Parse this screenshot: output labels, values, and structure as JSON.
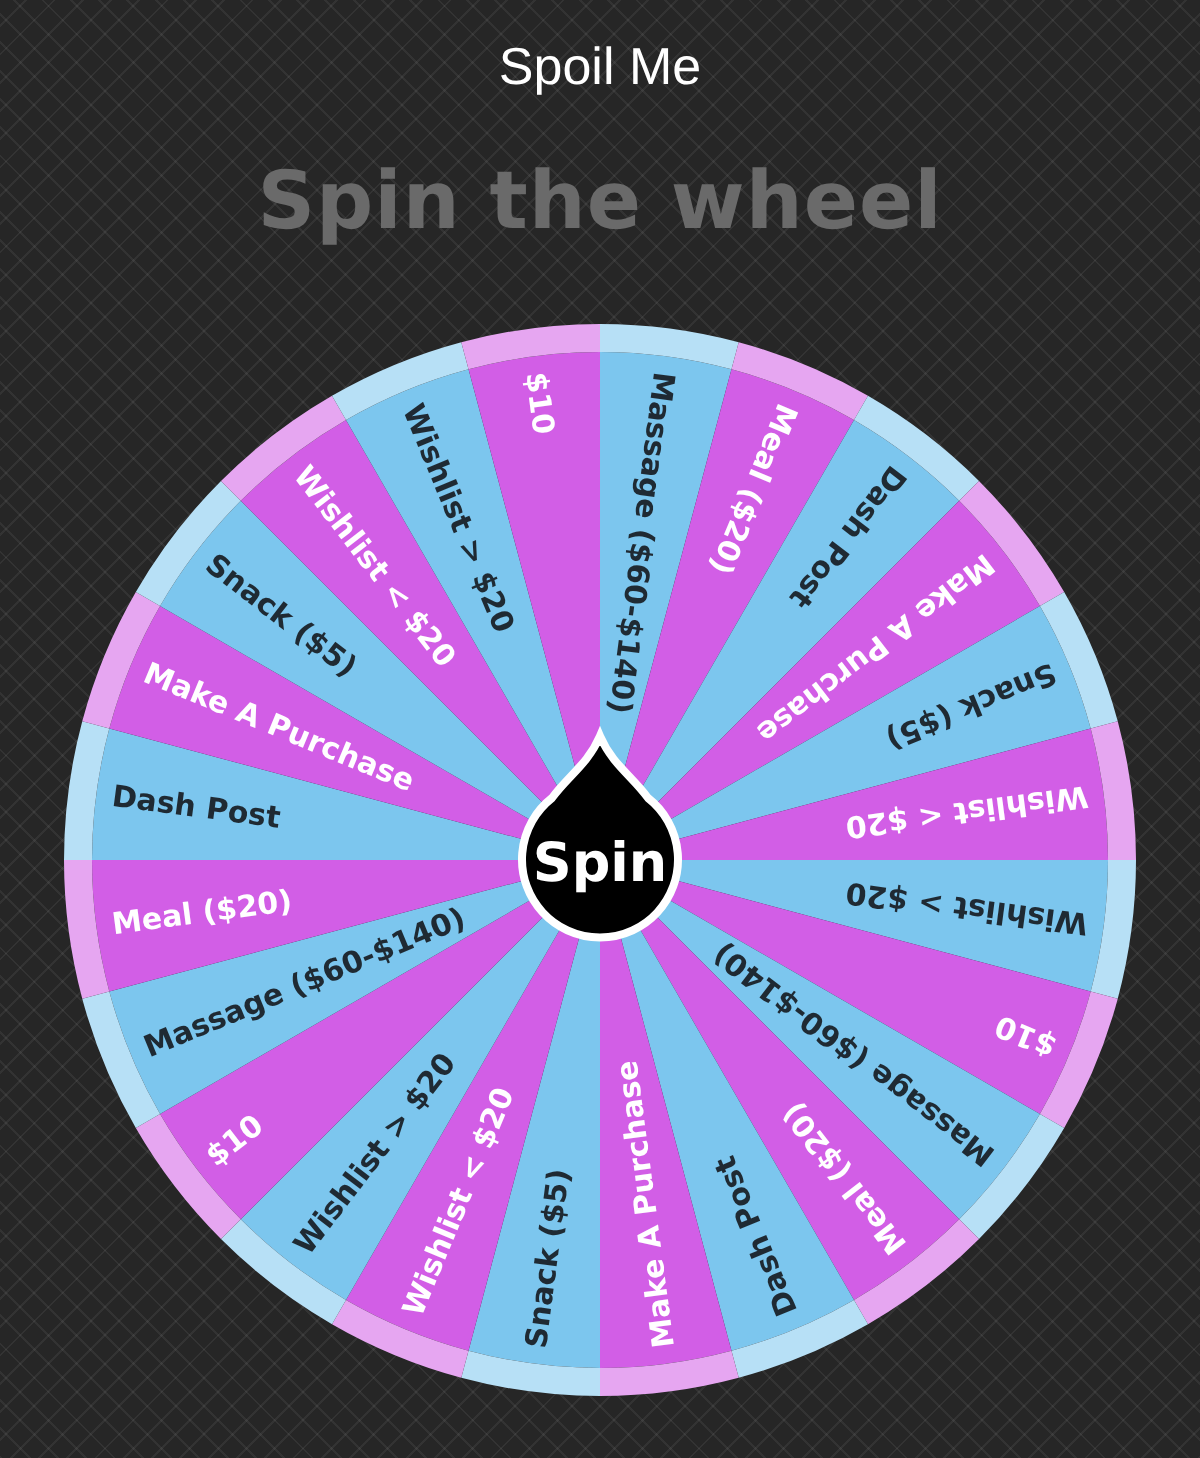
{
  "header": {
    "title": "Spoil Me"
  },
  "heading": "Spin the wheel",
  "wheel": {
    "segments": [
      {
        "label": "Massage ($60-$140)",
        "color": "#7cc6ee"
      },
      {
        "label": "Meal ($20)",
        "color": "#d25ee6"
      },
      {
        "label": "Dash Post",
        "color": "#7cc6ee"
      },
      {
        "label": "Make A Purchase",
        "color": "#d25ee6"
      },
      {
        "label": "Snack ($5)",
        "color": "#7cc6ee"
      },
      {
        "label": "Wishlist < $20",
        "color": "#d25ee6"
      },
      {
        "label": "Wishlist > $20",
        "color": "#7cc6ee"
      },
      {
        "label": "$10",
        "color": "#d25ee6"
      },
      {
        "label": "Massage ($60-$140)",
        "color": "#7cc6ee"
      },
      {
        "label": "Meal ($20)",
        "color": "#d25ee6"
      },
      {
        "label": "Dash Post",
        "color": "#7cc6ee"
      },
      {
        "label": "Make A Purchase",
        "color": "#d25ee6"
      },
      {
        "label": "Snack ($5)",
        "color": "#7cc6ee"
      },
      {
        "label": "Wishlist < $20",
        "color": "#d25ee6"
      },
      {
        "label": "Wishlist > $20",
        "color": "#7cc6ee"
      },
      {
        "label": "$10",
        "color": "#d25ee6"
      },
      {
        "label": "Massage ($60-$140)",
        "color": "#7cc6ee"
      },
      {
        "label": "Meal ($20)",
        "color": "#d25ee6"
      },
      {
        "label": "Dash Post",
        "color": "#7cc6ee"
      },
      {
        "label": "Make A Purchase",
        "color": "#d25ee6"
      },
      {
        "label": "Snack ($5)",
        "color": "#7cc6ee"
      },
      {
        "label": "Wishlist < $20",
        "color": "#d25ee6"
      },
      {
        "label": "Wishlist > $20",
        "color": "#7cc6ee"
      },
      {
        "label": "$10",
        "color": "#d25ee6"
      }
    ],
    "button": "Spin"
  }
}
